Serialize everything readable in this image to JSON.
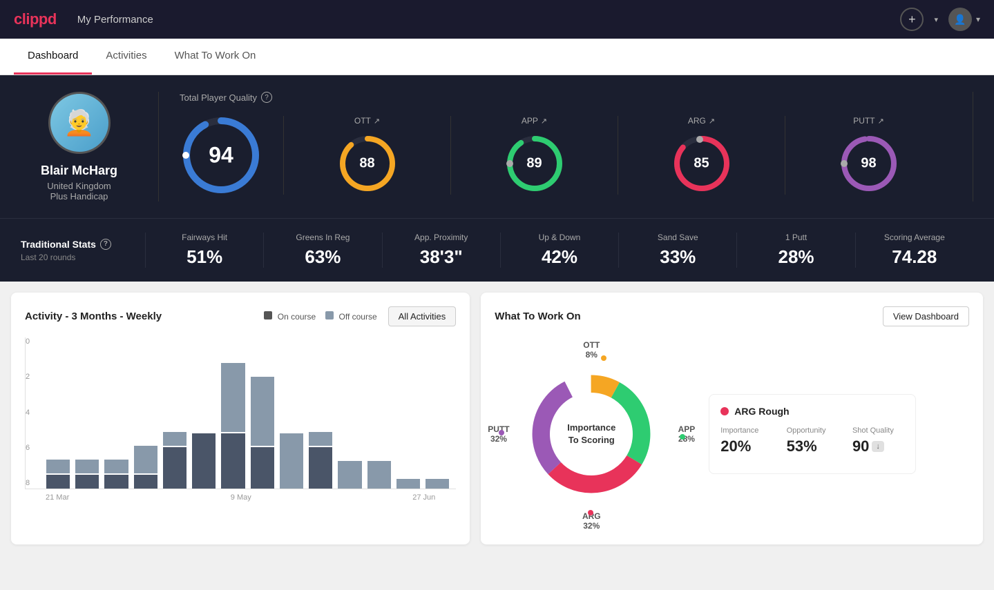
{
  "app": {
    "logo": "clippd",
    "header_title": "My Performance",
    "add_icon": "+",
    "avatar_icon": "👤",
    "chevron": "▾"
  },
  "nav": {
    "tabs": [
      {
        "label": "Dashboard",
        "active": true
      },
      {
        "label": "Activities",
        "active": false
      },
      {
        "label": "What To Work On",
        "active": false
      }
    ]
  },
  "player": {
    "name": "Blair McHarg",
    "country": "United Kingdom",
    "handicap": "Plus Handicap",
    "avatar_emoji": "🧑‍🦳"
  },
  "quality": {
    "title": "Total Player Quality",
    "main_score": "94",
    "sub_scores": [
      {
        "label": "OTT",
        "value": "88",
        "color": "#f5a623",
        "bg": "#2a2e3e"
      },
      {
        "label": "APP",
        "value": "89",
        "color": "#2ecc71",
        "bg": "#2a2e3e"
      },
      {
        "label": "ARG",
        "value": "85",
        "color": "#e8335a",
        "bg": "#2a2e3e"
      },
      {
        "label": "PUTT",
        "value": "98",
        "color": "#9b59b6",
        "bg": "#2a2e3e"
      }
    ]
  },
  "trad_stats": {
    "title": "Traditional Stats",
    "subtitle": "Last 20 rounds",
    "items": [
      {
        "label": "Fairways Hit",
        "value": "51%"
      },
      {
        "label": "Greens In Reg",
        "value": "63%"
      },
      {
        "label": "App. Proximity",
        "value": "38'3\""
      },
      {
        "label": "Up & Down",
        "value": "42%"
      },
      {
        "label": "Sand Save",
        "value": "33%"
      },
      {
        "label": "1 Putt",
        "value": "28%"
      },
      {
        "label": "Scoring Average",
        "value": "74.28"
      }
    ]
  },
  "activity_chart": {
    "title": "Activity - 3 Months - Weekly",
    "legend": {
      "on_course": "On course",
      "off_course": "Off course"
    },
    "all_activities_btn": "All Activities",
    "y_labels": [
      "0",
      "2",
      "4",
      "6",
      "8"
    ],
    "x_labels": [
      "21 Mar",
      "9 May",
      "27 Jun"
    ],
    "bars": [
      {
        "on": 1,
        "off": 1
      },
      {
        "on": 1,
        "off": 1
      },
      {
        "on": 1,
        "off": 1
      },
      {
        "on": 1,
        "off": 2
      },
      {
        "on": 3,
        "off": 1
      },
      {
        "on": 4,
        "off": 0
      },
      {
        "on": 4,
        "off": 5
      },
      {
        "on": 3,
        "off": 5
      },
      {
        "on": 0,
        "off": 4
      },
      {
        "on": 3,
        "off": 1
      },
      {
        "on": 0,
        "off": 2
      },
      {
        "on": 0,
        "off": 2
      },
      {
        "on": 0,
        "off": 0.7
      },
      {
        "on": 0,
        "off": 0.7
      }
    ]
  },
  "wtwo": {
    "title": "What To Work On",
    "view_dashboard_btn": "View Dashboard",
    "donut": {
      "center_label": "Importance\nTo Scoring",
      "segments": [
        {
          "label": "OTT",
          "value": "8%",
          "color": "#f5a623",
          "pct": 8
        },
        {
          "label": "APP",
          "value": "28%",
          "color": "#2ecc71",
          "pct": 28
        },
        {
          "label": "ARG",
          "value": "32%",
          "color": "#e8335a",
          "pct": 32
        },
        {
          "label": "PUTT",
          "value": "32%",
          "color": "#9b59b6",
          "pct": 32
        }
      ]
    },
    "card": {
      "title": "ARG Rough",
      "dot_color": "#e8335a",
      "metrics": [
        {
          "label": "Importance",
          "value": "20%"
        },
        {
          "label": "Opportunity",
          "value": "53%"
        },
        {
          "label": "Shot Quality",
          "value": "90",
          "badge": "↓"
        }
      ]
    }
  }
}
